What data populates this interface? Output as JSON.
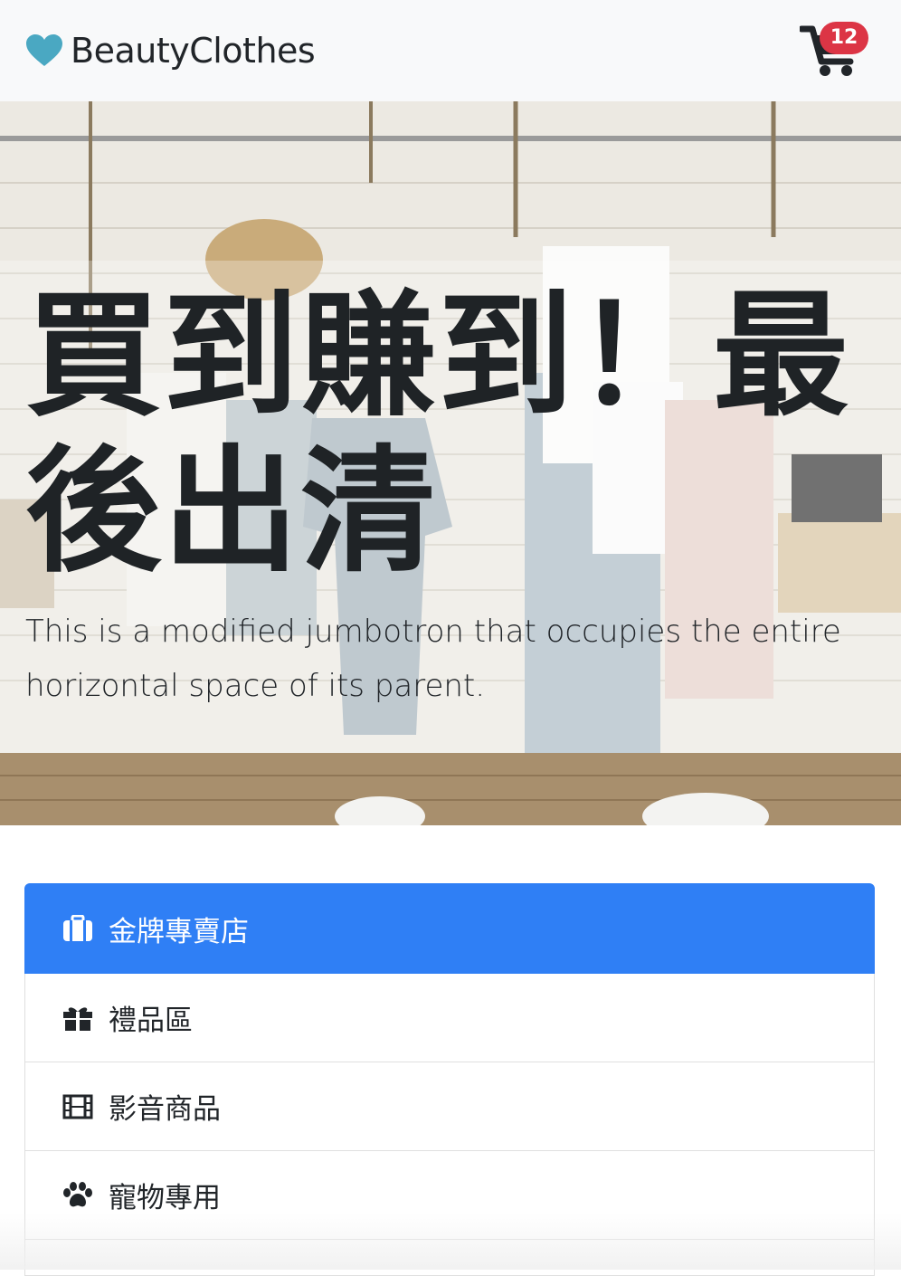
{
  "navbar": {
    "brand_name": "BeautyClothes",
    "brand_icon": "heart-icon",
    "brand_color": "#4aa8c2",
    "cart_icon": "shopping-cart-icon",
    "cart_count": "12",
    "badge_color": "#dc3545"
  },
  "hero": {
    "headline": "買到賺到！最後出清",
    "lead": "This is a modified jumbotron that occupies the entire horizontal space of its parent."
  },
  "menu": {
    "active_color": "#2f7ff5",
    "items": [
      {
        "label": "金牌專賣店",
        "icon": "briefcase-icon",
        "active": true
      },
      {
        "label": "禮品區",
        "icon": "gift-icon",
        "active": false
      },
      {
        "label": "影音商品",
        "icon": "film-icon",
        "active": false
      },
      {
        "label": "寵物專用",
        "icon": "paw-icon",
        "active": false
      }
    ]
  }
}
